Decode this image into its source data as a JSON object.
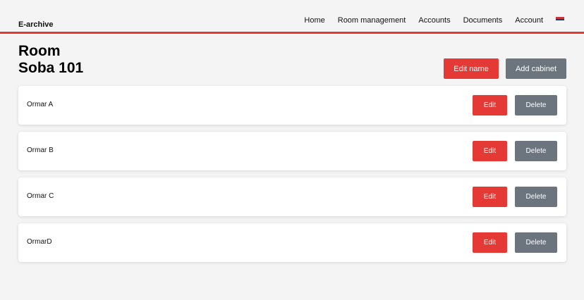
{
  "brand": "E-archive",
  "nav": {
    "items": [
      "Home",
      "Room management",
      "Accounts",
      "Documents",
      "Account"
    ],
    "flag": {
      "icon": "serbia-flag-icon",
      "colors": [
        "#c6363c",
        "#0c4076",
        "#ffffff"
      ]
    }
  },
  "page": {
    "title_line1": "Room",
    "title_line2": "Soba 101",
    "edit_name_label": "Edit name",
    "add_cabinet_label": "Add cabinet"
  },
  "cabinets": [
    {
      "name": "Ormar A",
      "edit_label": "Edit",
      "delete_label": "Delete"
    },
    {
      "name": "Ormar B",
      "edit_label": "Edit",
      "delete_label": "Delete"
    },
    {
      "name": "Ormar C",
      "edit_label": "Edit",
      "delete_label": "Delete"
    },
    {
      "name": "OrmarD",
      "edit_label": "Edit",
      "delete_label": "Delete"
    }
  ],
  "colors": {
    "accent": "#e53935",
    "secondary": "#6c757d",
    "background": "#f4f4f4"
  }
}
